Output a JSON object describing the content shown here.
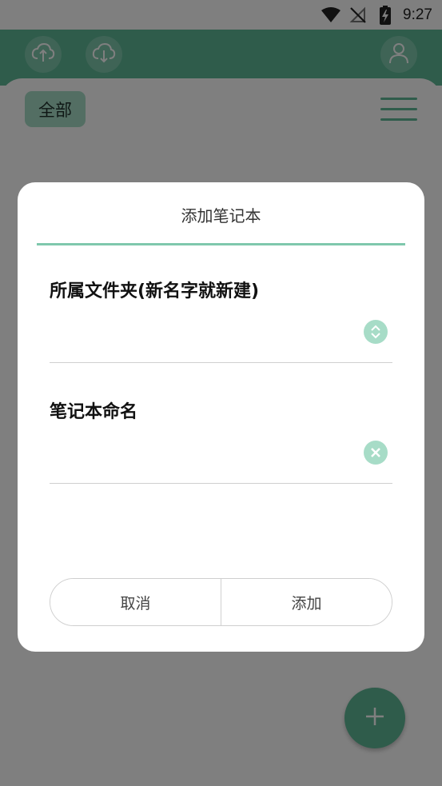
{
  "status_bar": {
    "time": "9:27",
    "icons": [
      "wifi-icon",
      "no-signal-icon",
      "battery-charging-icon"
    ]
  },
  "header": {
    "left_buttons": [
      "cloud-upload-icon",
      "cloud-download-icon"
    ],
    "right_button": "user-icon"
  },
  "main": {
    "filter_chip_label": "全部",
    "menu_icon": "menu-icon",
    "fab_icon": "plus-icon"
  },
  "dialog": {
    "title": "添加笔记本",
    "folder_field": {
      "label": "所属文件夹(新名字就新建)",
      "value": "",
      "icon": "chevron-up-down-icon"
    },
    "name_field": {
      "label": "笔记本命名",
      "value": "",
      "icon": "clear-icon"
    },
    "cancel_label": "取消",
    "add_label": "添加"
  },
  "colors": {
    "accent": "#5fb897",
    "accent_light": "#a7dcc7",
    "divider": "#7fc8ad"
  }
}
